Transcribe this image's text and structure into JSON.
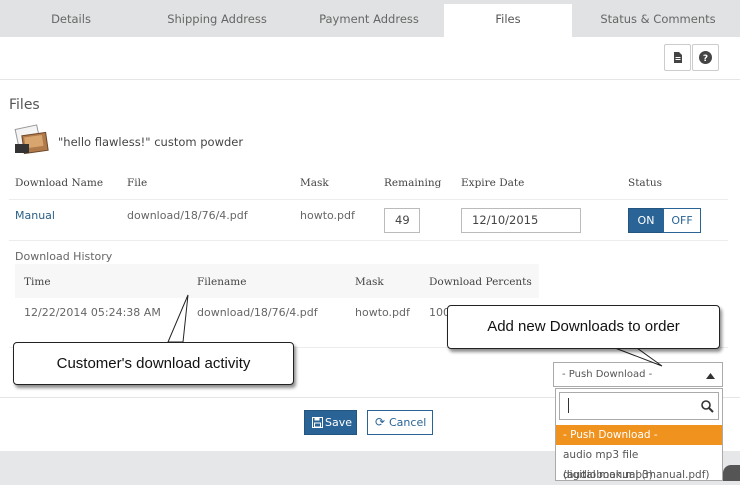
{
  "tabs": [
    {
      "label": "Details"
    },
    {
      "label": "Shipping Address"
    },
    {
      "label": "Payment Address"
    },
    {
      "label": "Files"
    },
    {
      "label": "Status & Comments"
    }
  ],
  "section_title": "Files",
  "product_name": "\"hello flawless!\" custom powder",
  "downloads_table": {
    "headers": [
      "Download Name",
      "File",
      "Mask",
      "Remaining",
      "Expire Date",
      "Status"
    ],
    "row": {
      "name": "Manual",
      "file": "download/18/76/4.pdf",
      "mask": "howto.pdf",
      "remaining": "49",
      "expire_date": "12/10/2015",
      "status_on": "ON",
      "status_off": "OFF"
    }
  },
  "history": {
    "title": "Download History",
    "headers": [
      "Time",
      "Filename",
      "Mask",
      "Download Percents"
    ],
    "row": {
      "time": "12/22/2014 05:24:38 AM",
      "filename": "download/18/76/4.pdf",
      "mask": "howto.pdf",
      "percent": "100"
    }
  },
  "callouts": {
    "activity": "Customer's download activity",
    "add_new": "Add new Downloads to order"
  },
  "push_download": {
    "selected": "- Push Download -",
    "options": [
      "- Push Download -",
      "audio mp3 file (audiobook.mp3)",
      "digital manual (manual.pdf)"
    ]
  },
  "buttons": {
    "save": "Save",
    "cancel": "Cancel"
  },
  "colors": {
    "accent": "#2a6496",
    "highlight": "#f0921e"
  }
}
